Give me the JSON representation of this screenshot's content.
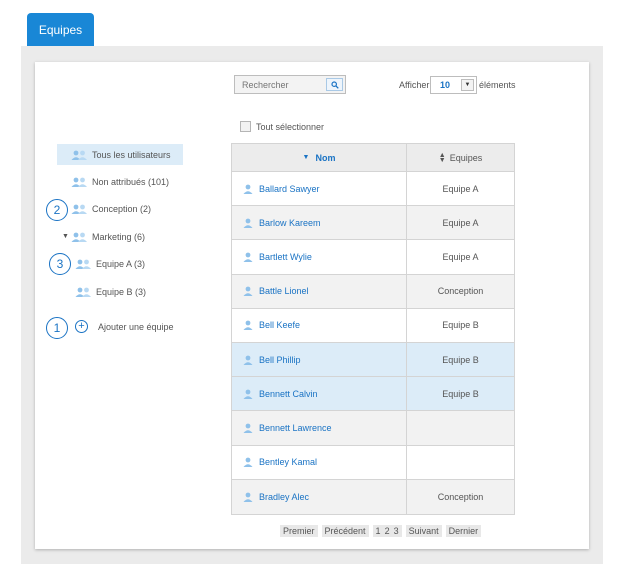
{
  "tab": {
    "label": "Equipes"
  },
  "search": {
    "placeholder": "Rechercher"
  },
  "page_size": {
    "prefix": "Afficher",
    "value": "10",
    "suffix": "éléments"
  },
  "select_all": {
    "label": "Tout sélectionner"
  },
  "sidebar": {
    "items": [
      {
        "label": "Tous les utilisateurs",
        "active": true
      },
      {
        "label": "Non attribués (101)"
      },
      {
        "label": "Conception (2)"
      },
      {
        "label": "Marketing (6)",
        "expanded": true
      },
      {
        "label": "Equipe A (3)"
      },
      {
        "label": "Equipe B (3)"
      }
    ],
    "add_team": "Ajouter une équipe"
  },
  "callouts": [
    "1",
    "2",
    "3"
  ],
  "table": {
    "headers": {
      "name": "Nom",
      "teams": "Equipes"
    },
    "rows": [
      {
        "name": "Ballard Sawyer",
        "team": "Equipe A",
        "style": "normal"
      },
      {
        "name": "Barlow Kareem",
        "team": "Equipe A",
        "style": "alt"
      },
      {
        "name": "Bartlett Wylie",
        "team": "Equipe A",
        "style": "normal"
      },
      {
        "name": "Battle Lionel",
        "team": "Conception",
        "style": "alt"
      },
      {
        "name": "Bell Keefe",
        "team": "Equipe B",
        "style": "normal"
      },
      {
        "name": "Bell Phillip",
        "team": "Equipe B",
        "style": "selected"
      },
      {
        "name": "Bennett Calvin",
        "team": "Equipe B",
        "style": "selected"
      },
      {
        "name": "Bennett Lawrence",
        "team": "",
        "style": "alt"
      },
      {
        "name": "Bentley Kamal",
        "team": "",
        "style": "normal"
      },
      {
        "name": "Bradley Alec",
        "team": "Conception",
        "style": "alt"
      }
    ]
  },
  "pagination": {
    "first": "Premier",
    "prev": "Précédent",
    "pages": [
      "1",
      "2",
      "3"
    ],
    "next": "Suivant",
    "last": "Dernier"
  },
  "colors": {
    "accent": "#1987d6",
    "link": "#1a73c4",
    "selected_row": "#dcecf8"
  }
}
